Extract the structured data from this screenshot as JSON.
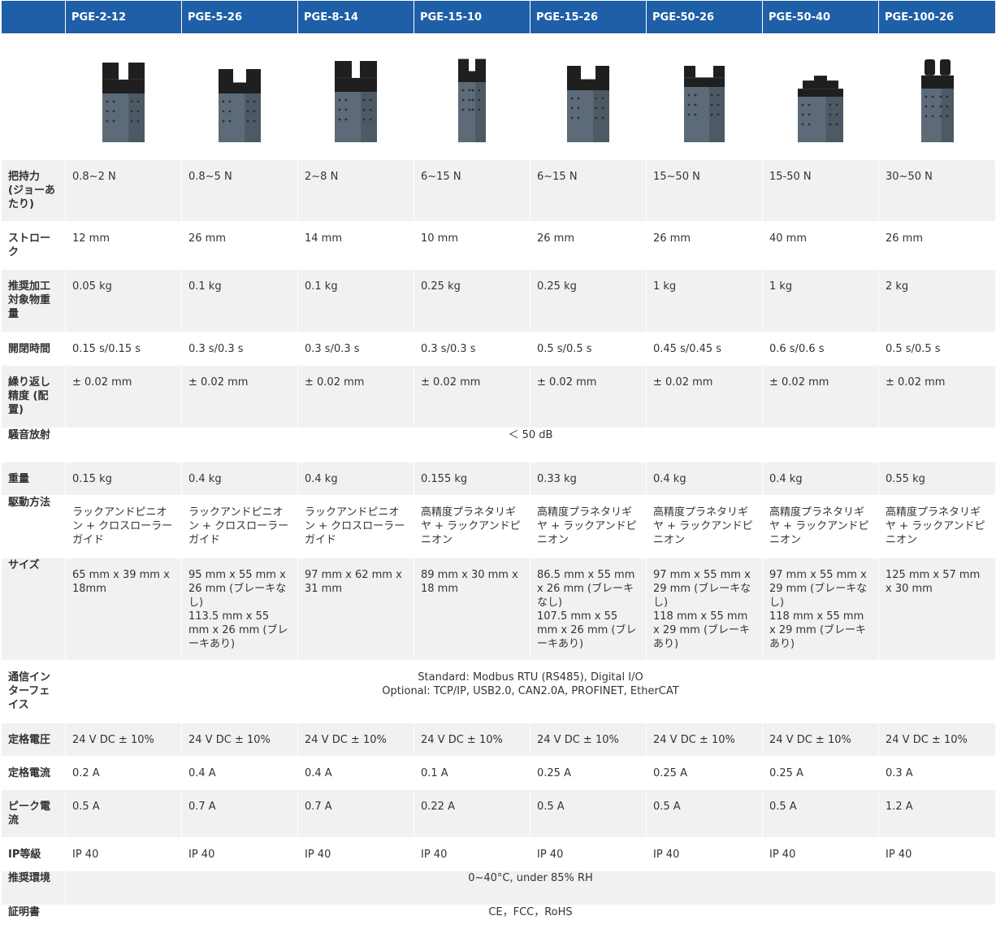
{
  "header": {
    "corner": "",
    "models": [
      "PGE-2-12",
      "PGE-5-26",
      "PGE-8-14",
      "PGE-15-10",
      "PGE-15-26",
      "PGE-50-26",
      "PGE-50-40",
      "PGE-100-26"
    ]
  },
  "images": {
    "icon_names": [
      "gripper-icon",
      "gripper-icon",
      "gripper-icon",
      "gripper-icon",
      "gripper-icon",
      "gripper-icon",
      "gripper-icon",
      "gripper-icon"
    ],
    "body_color": "#5d6b78",
    "top_color": "#1f1f1f"
  },
  "rows": [
    {
      "label": "把持力 (ジョーあたり)",
      "values": [
        "0.8~2 N",
        "0.8~5 N",
        "2~8 N",
        "6~15 N",
        "6~15 N",
        "15~50 N",
        "15-50 N",
        "30~50 N"
      ]
    },
    {
      "label": "ストローク",
      "values": [
        "12 mm",
        "26 mm",
        "14 mm",
        "10 mm",
        "26 mm",
        "26 mm",
        "40 mm",
        "26 mm"
      ]
    },
    {
      "label": "推奨加工対象物重量",
      "values": [
        "0.05 kg",
        "0.1 kg",
        "0.1 kg",
        "0.25 kg",
        "0.25 kg",
        "1 kg",
        "1 kg",
        "2 kg"
      ]
    },
    {
      "label": "開閉時間",
      "values": [
        "0.15 s/0.15 s",
        "0.3 s/0.3 s",
        "0.3 s/0.3 s",
        "0.3 s/0.3 s",
        "0.5 s/0.5 s",
        "0.45 s/0.45 s",
        "0.6 s/0.6 s",
        "0.5 s/0.5 s"
      ]
    },
    {
      "label": "繰り返し精度 (配置)",
      "values": [
        "± 0.02 mm",
        "± 0.02 mm",
        "± 0.02 mm",
        "± 0.02 mm",
        "± 0.02 mm",
        "± 0.02 mm",
        "± 0.02 mm",
        "± 0.02 mm"
      ]
    },
    {
      "label": "騒音放射",
      "span": "＜ 50 dB"
    },
    {
      "label": "重量",
      "values": [
        "0.15 kg",
        "0.4 kg",
        "0.4 kg",
        "0.155 kg",
        "0.33 kg",
        "0.4 kg",
        "0.4 kg",
        "0.55 kg"
      ]
    },
    {
      "label": "駆動方法",
      "values": [
        "ラックアンドピニオン + クロスローラーガイド",
        "ラックアンドピニオン + クロスローラーガイド",
        "ラックアンドピニオン + クロスローラーガイド",
        "高精度プラネタリギヤ + ラックアンドピニオン",
        "高精度プラネタリギヤ + ラックアンドピニオン",
        "高精度プラネタリギヤ + ラックアンドピニオン",
        "高精度プラネタリギヤ + ラックアンドピニオン",
        "高精度プラネタリギヤ + ラックアンドピニオン"
      ]
    },
    {
      "label": "サイズ",
      "values": [
        [
          "65 mm x 39 mm x 18mm"
        ],
        [
          "95 mm x 55 mm x 26 mm (ブレーキなし)",
          "113.5 mm x 55 mm x 26 mm (ブレーキあり)"
        ],
        [
          "97 mm x 62 mm x 31 mm"
        ],
        [
          "89 mm x 30 mm x 18 mm"
        ],
        [
          "86.5 mm x 55 mm x 26 mm (ブレーキなし)",
          "107.5 mm x 55 mm x 26 mm (ブレーキあり)"
        ],
        [
          "97 mm x 55 mm x 29 mm (ブレーキなし)",
          "118 mm x 55 mm x 29 mm (ブレーキあり)"
        ],
        [
          "97 mm x 55 mm x 29 mm (ブレーキなし)",
          "118 mm x 55 mm x 29 mm (ブレーキあり)"
        ],
        [
          "125 mm x 57 mm x 30 mm"
        ]
      ]
    },
    {
      "label": "通信インターフェイス",
      "span_lines": [
        "Standard: Modbus RTU (RS485), Digital I/O",
        "Optional: TCP/IP, USB2.0, CAN2.0A, PROFINET, EtherCAT"
      ]
    },
    {
      "label": "定格電圧",
      "values": [
        "24 V DC ± 10%",
        "24 V DC ± 10%",
        "24 V DC ± 10%",
        "24 V DC ± 10%",
        "24 V DC ± 10%",
        "24 V DC ± 10%",
        "24 V DC ± 10%",
        "24 V DC ± 10%"
      ]
    },
    {
      "label": "定格電流",
      "values": [
        "0.2 A",
        "0.4 A",
        "0.4 A",
        "0.1 A",
        "0.25 A",
        "0.25 A",
        "0.25 A",
        "0.3 A"
      ]
    },
    {
      "label": "ピーク電流",
      "values": [
        "0.5 A",
        "0.7 A",
        "0.7 A",
        "0.22 A",
        "0.5 A",
        "0.5 A",
        "0.5 A",
        "1.2 A"
      ]
    },
    {
      "label": "IP等級",
      "values": [
        "IP 40",
        "IP 40",
        "IP 40",
        "IP 40",
        "IP 40",
        "IP 40",
        "IP 40",
        "IP 40"
      ]
    },
    {
      "label": "推奨環境",
      "span": "0~40°C, under 85% RH"
    },
    {
      "label": "証明書",
      "span": "CE，FCC，RoHS"
    }
  ]
}
